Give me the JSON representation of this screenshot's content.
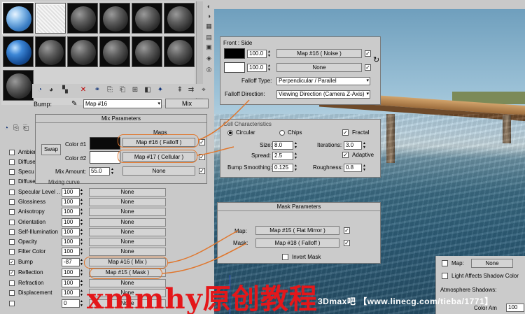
{
  "material_editor": {
    "bump_label": "Bump:",
    "bump_map": "Map #16",
    "map_type_button": "Mix"
  },
  "maps_rollout": {
    "rows": [
      {
        "checked": false,
        "label": "Ambien",
        "amount": "",
        "map": ""
      },
      {
        "checked": false,
        "label": "Diffuse",
        "amount": "",
        "map": ""
      },
      {
        "checked": false,
        "label": "Specu",
        "amount": "",
        "map": ""
      },
      {
        "checked": false,
        "label": "Diffuse",
        "amount": "",
        "map": ""
      },
      {
        "checked": false,
        "label": "Specular Level ..",
        "amount": "100",
        "map": "None"
      },
      {
        "checked": false,
        "label": "Glossiness",
        "amount": "100",
        "map": "None"
      },
      {
        "checked": false,
        "label": "Anisotropy",
        "amount": "100",
        "map": "None"
      },
      {
        "checked": false,
        "label": "Orientation",
        "amount": "100",
        "map": "None"
      },
      {
        "checked": false,
        "label": "Self-Illumination",
        "amount": "100",
        "map": "None"
      },
      {
        "checked": false,
        "label": "Opacity",
        "amount": "100",
        "map": "None"
      },
      {
        "checked": false,
        "label": "Filter Color",
        "amount": "100",
        "map": "None"
      },
      {
        "checked": true,
        "label": "Bump",
        "amount": "-87",
        "map": "Map #16 ( Mix )"
      },
      {
        "checked": true,
        "label": "Reflection",
        "amount": "100",
        "map": "Map #15 ( Mask )"
      },
      {
        "checked": false,
        "label": "Refraction",
        "amount": "100",
        "map": "None"
      },
      {
        "checked": false,
        "label": "Displacement",
        "amount": "100",
        "map": "None"
      },
      {
        "checked": false,
        "label": "",
        "amount": "0",
        "map": "None"
      },
      {
        "checked": false,
        "label": "",
        "amount": "0",
        "map": "None"
      }
    ]
  },
  "mix_parameters": {
    "title": "Mix Parameters",
    "maps_label": "Maps",
    "swap_label": "Swap",
    "color1_label": "Color #1",
    "color1_map": "Map #16  ( Falloff )",
    "color1_swatch": "#0a0a0a",
    "color2_label": "Color #2",
    "color2_map": "Map #17  ( Cellular )",
    "color2_swatch": "#ffffff",
    "mix_amount_label": "Mix Amount:",
    "mix_amount": "55.0",
    "mix_map": "None",
    "mixing_curve_label": "Mixing curve"
  },
  "falloff_panel": {
    "title": "Front : Side",
    "row1_value": "100.0",
    "row1_map": "Map #16  ( Noise )",
    "row1_swatch": "#000000",
    "row2_value": "100.0",
    "row2_map": "None",
    "row2_swatch": "#ffffff",
    "falloff_type_label": "Falloff Type:",
    "falloff_type": "Perpendicular / Parallel",
    "falloff_direction_label": "Falloff Direction:",
    "falloff_direction": "Viewing Direction (Camera Z-Axis)"
  },
  "cellular_panel": {
    "title": "Cell Characteristics",
    "circular_label": "Circular",
    "chips_label": "Chips",
    "fractal_label": "Fractal",
    "size_label": "Size:",
    "size_value": "8.0",
    "spread_label": "Spread:",
    "spread_value": "2.5",
    "bump_smoothing_label": "Bump Smoothing:",
    "bump_smoothing_value": "0.125",
    "iterations_label": "Iterations:",
    "iterations_value": "3.0",
    "adaptive_label": "Adaptive",
    "roughness_label": "Roughness:",
    "roughness_value": "0.8"
  },
  "mask_parameters": {
    "title": "Mask Parameters",
    "map_label": "Map:",
    "map_value": "Map #15  ( Flat Mirror )",
    "mask_label": "Mask:",
    "mask_value": "Map #18  ( Falloff )",
    "invert_label": "Invert Mask"
  },
  "right_props": {
    "map_label": "Map:",
    "map_value": "None",
    "light_affects": "Light Affects Shadow Color",
    "atmosphere_label": "Atmosphere Shadows:",
    "color_amount_label": "Color Am",
    "color_amount_value": "100"
  },
  "watermark": {
    "main": "xmmhy原创教程",
    "sub": "3Dmax吧 【www.linecg.com/tieba/1771】"
  },
  "colors": {
    "annotation": "#e0762c",
    "watermark_red": "#e4171a"
  }
}
